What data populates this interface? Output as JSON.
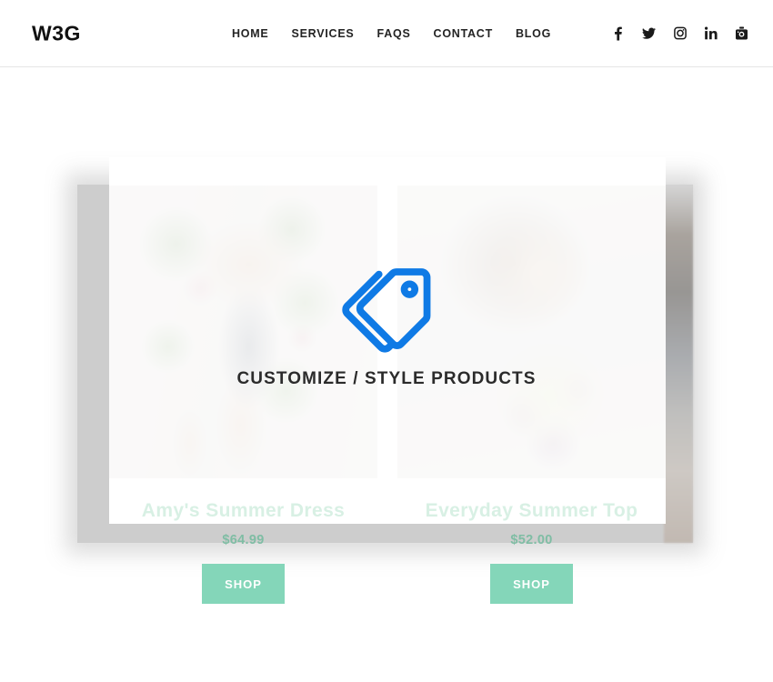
{
  "header": {
    "logo": "W3G",
    "nav": [
      {
        "label": "HOME",
        "name": "nav-link-home"
      },
      {
        "label": "SERVICES",
        "name": "nav-link-services"
      },
      {
        "label": "FAQS",
        "name": "nav-link-faqs"
      },
      {
        "label": "CONTACT",
        "name": "nav-link-contact"
      },
      {
        "label": "BLOG",
        "name": "nav-link-blog"
      }
    ],
    "social": [
      {
        "icon": "facebook-icon",
        "label": "Facebook"
      },
      {
        "icon": "twitter-icon",
        "label": "Twitter"
      },
      {
        "icon": "instagram-icon",
        "label": "Instagram"
      },
      {
        "icon": "linkedin-icon",
        "label": "LinkedIn"
      },
      {
        "icon": "youtube-icon",
        "label": "YouTube"
      }
    ]
  },
  "overlay": {
    "icon": "pricetags-icon",
    "icon_color": "#0f7ae5",
    "caption": "CUSTOMIZE / STYLE PRODUCTS"
  },
  "products": [
    {
      "title": "Amy's Summer Dress",
      "price": "$64.99",
      "button_label": "SHOP",
      "image_alt": "Woman seated on a flower-covered swing wearing a floral summer dress"
    },
    {
      "title": "Everyday Summer Top",
      "price": "$52.00",
      "button_label": "SHOP",
      "image_alt": "Smiling woman with flowing hair wearing a yellow floral summer top"
    }
  ],
  "theme": {
    "accent_mint": "#84d6b9",
    "price_green": "#7fbda4",
    "title_mint": "#d8f0e4",
    "overlay_blue": "#0f7ae5",
    "text_dark": "#232323",
    "panel_grey": "rgba(130,130,130,0.40)"
  }
}
